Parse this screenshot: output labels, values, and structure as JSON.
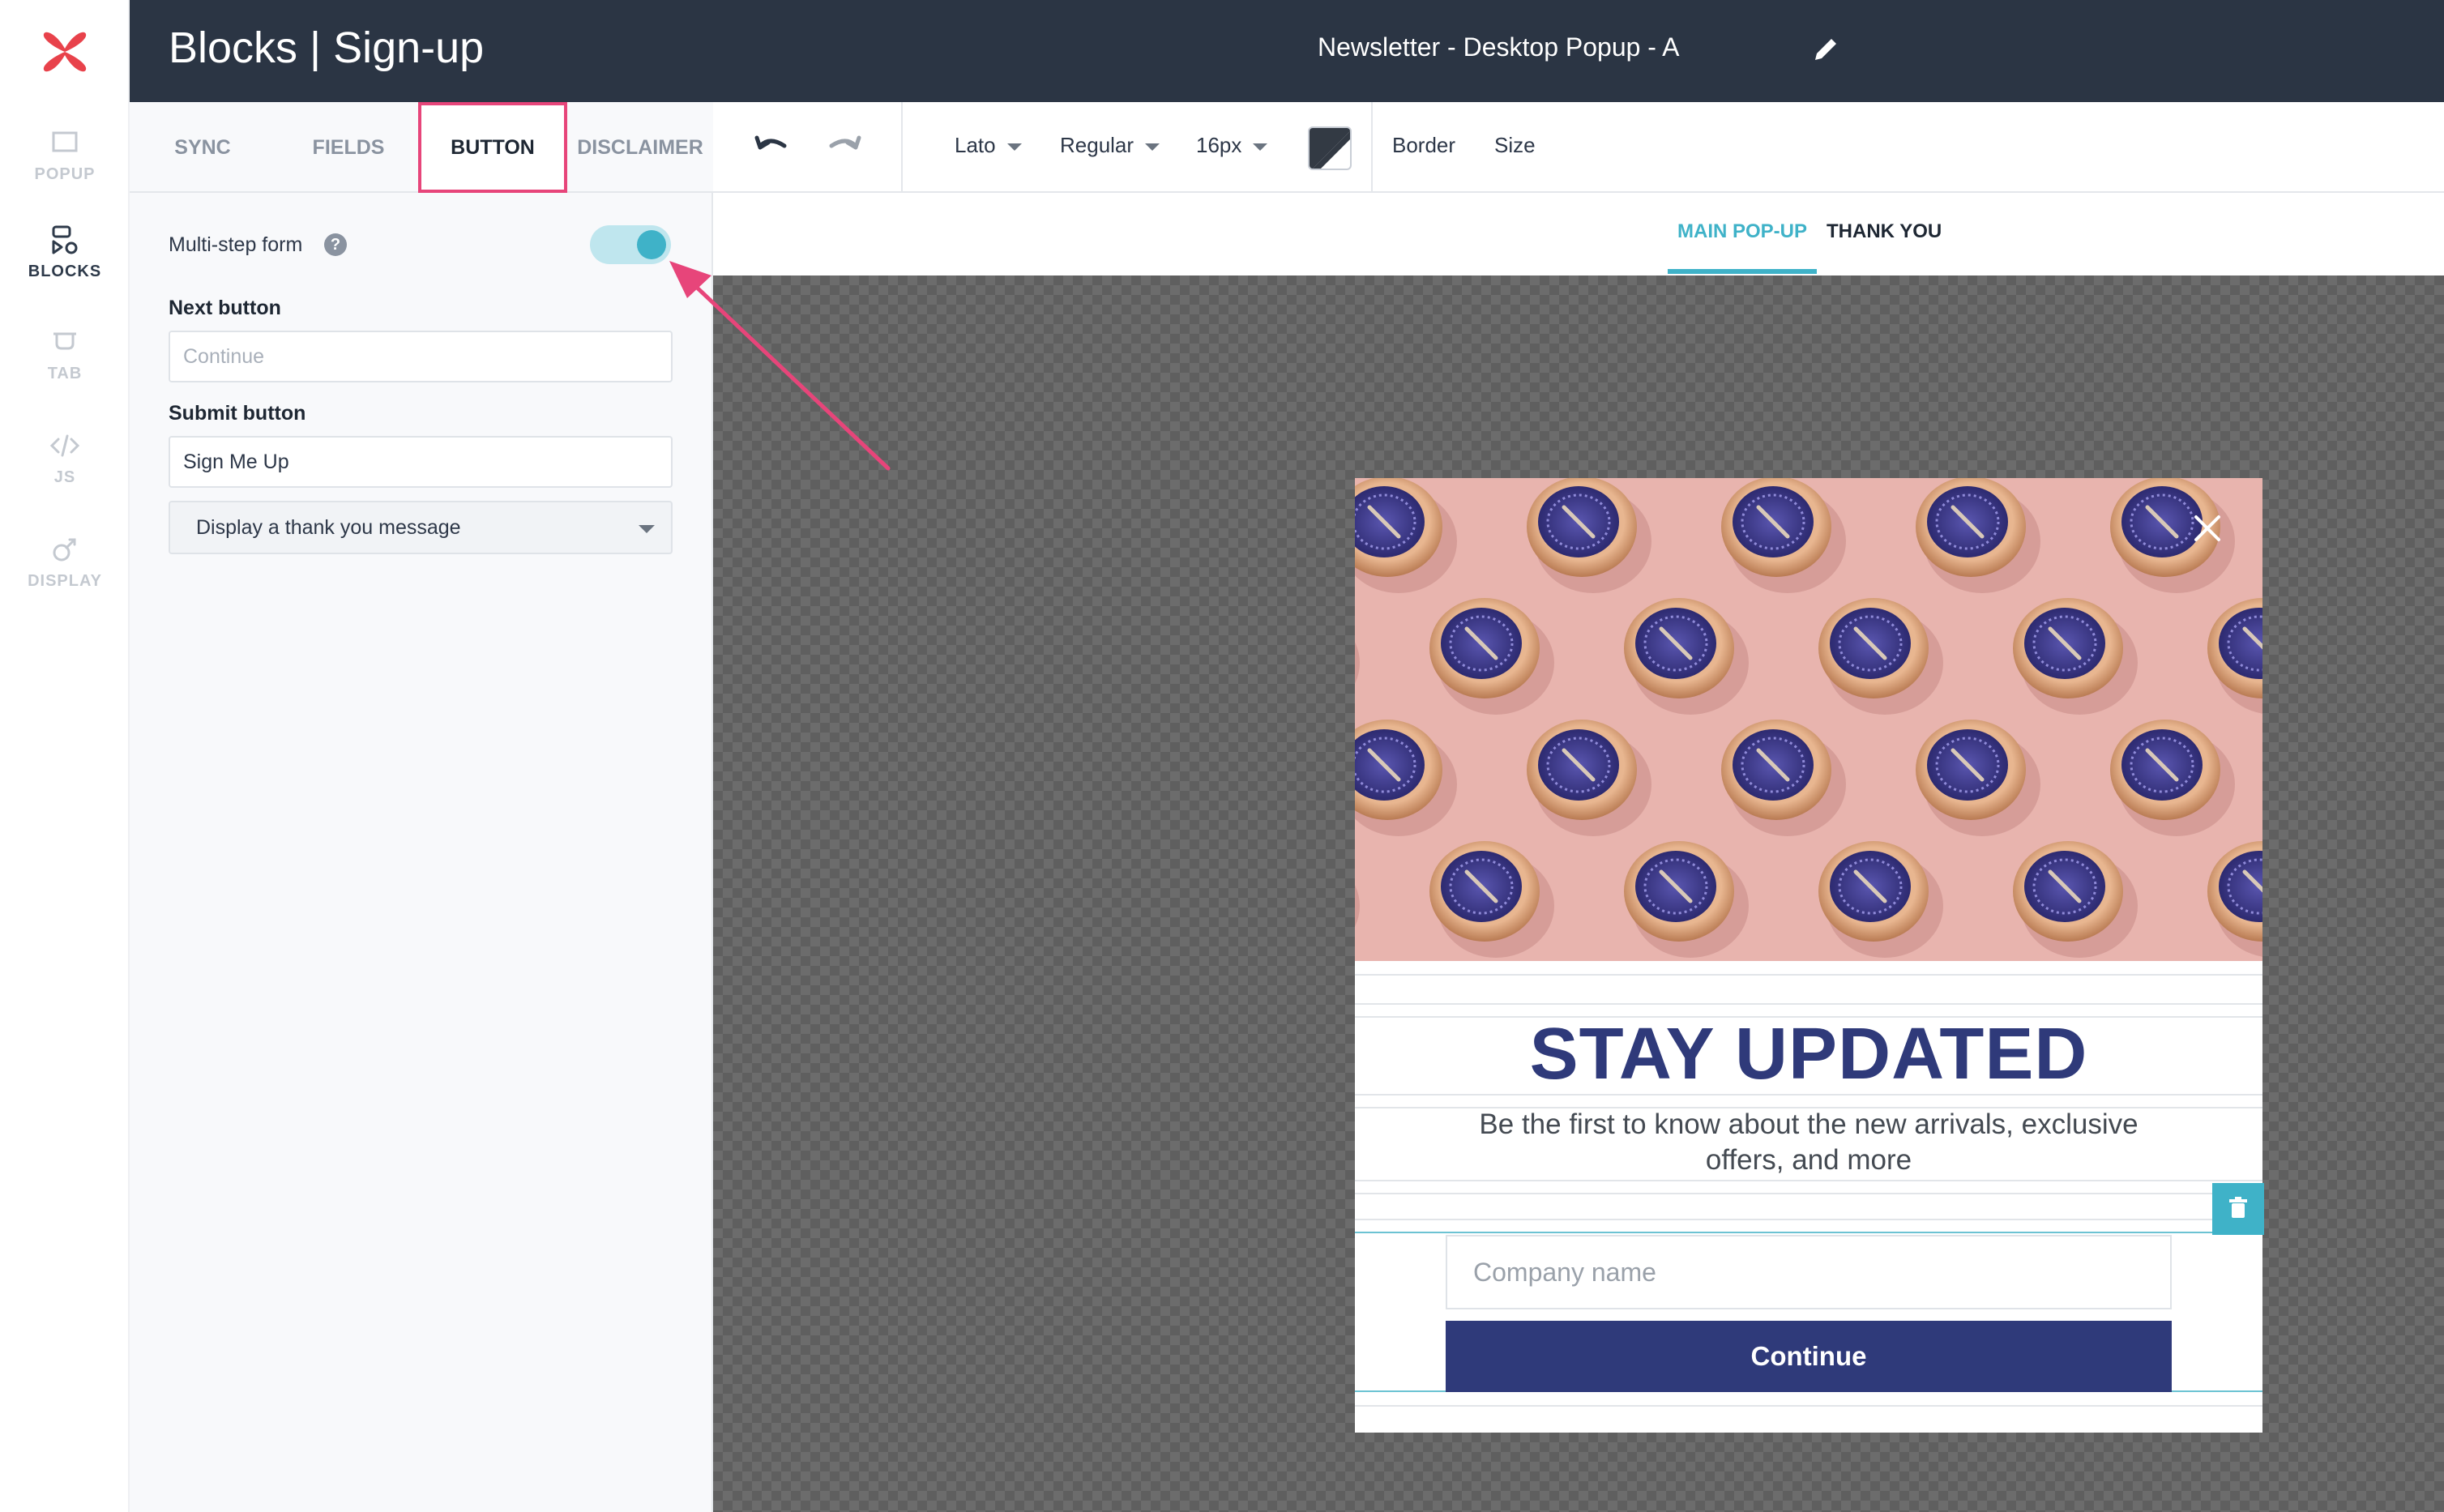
{
  "header": {
    "title": "Blocks | Sign-up",
    "popup_name": "Newsletter - Desktop Popup - A"
  },
  "rail": {
    "items": [
      {
        "label": "POPUP",
        "icon": "popup-icon",
        "active": false
      },
      {
        "label": "BLOCKS",
        "icon": "blocks-icon",
        "active": true
      },
      {
        "label": "TAB",
        "icon": "tab-icon",
        "active": false
      },
      {
        "label": "JS",
        "icon": "code-icon",
        "active": false
      },
      {
        "label": "DISPLAY",
        "icon": "display-icon",
        "active": false
      }
    ]
  },
  "panel": {
    "tabs": [
      {
        "label": "SYNC",
        "active": false
      },
      {
        "label": "FIELDS",
        "active": false
      },
      {
        "label": "BUTTON",
        "active": true
      },
      {
        "label": "DISCLAIMER",
        "active": false
      }
    ],
    "multistep_label": "Multi-step form",
    "multistep_enabled": true,
    "next_button_label": "Next button",
    "next_button_placeholder": "Continue",
    "submit_button_label": "Submit button",
    "submit_button_value": "Sign Me Up",
    "after_submit_selected": "Display a thank you message"
  },
  "toolbar": {
    "font": "Lato",
    "weight": "Regular",
    "size": "16px",
    "border_label": "Border",
    "size_label": "Size"
  },
  "view_tabs": {
    "main": "MAIN POP-UP",
    "thank_you": "THANK YOU"
  },
  "popup": {
    "title": "STAY UPDATED",
    "subtitle": "Be the first to know about the new arrivals, exclusive offers, and more",
    "input_placeholder": "Company name",
    "button_label": "Continue"
  },
  "colors": {
    "header_bg": "#2b3544",
    "accent_teal": "#3fb2c8",
    "highlight_pink": "#e7457a",
    "popup_navy": "#2f3a7a",
    "logo_red": "#e8424b"
  }
}
